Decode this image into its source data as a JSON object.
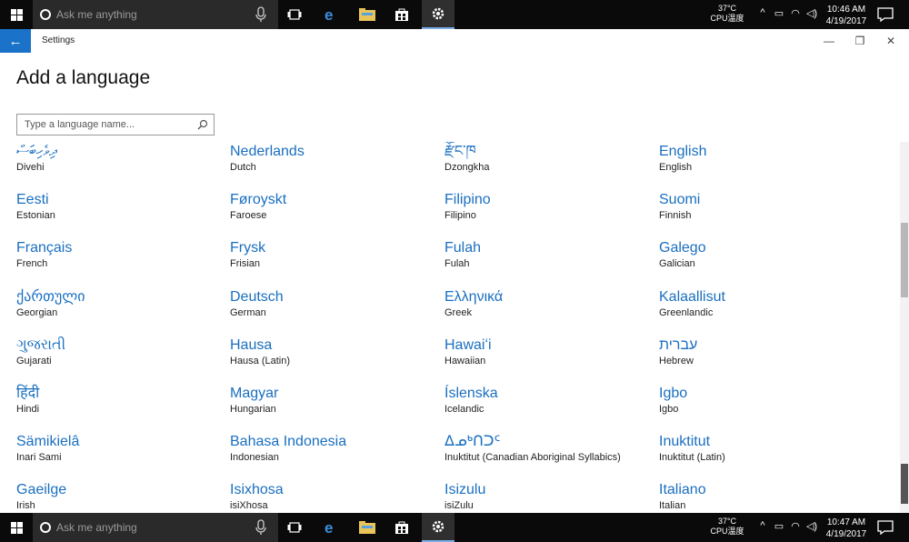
{
  "taskbar_top": {
    "search_placeholder": "Ask me anything",
    "temp": "37°C",
    "temp_label": "CPU温度",
    "time": "10:46 AM",
    "date": "4/19/2017"
  },
  "taskbar_bottom": {
    "search_placeholder": "Ask me anything",
    "temp": "37°C",
    "temp_label": "CPU温度",
    "time": "10:47 AM",
    "date": "4/19/2017"
  },
  "window": {
    "app_title": "Settings"
  },
  "page": {
    "title": "Add a language",
    "search_placeholder": "Type a language name..."
  },
  "languages": [
    {
      "native": "ދިވެހިބަސް",
      "english": "Divehi"
    },
    {
      "native": "Nederlands",
      "english": "Dutch"
    },
    {
      "native": "རྫོང་ཁ",
      "english": "Dzongkha"
    },
    {
      "native": "English",
      "english": "English"
    },
    {
      "native": "Eesti",
      "english": "Estonian"
    },
    {
      "native": "Føroyskt",
      "english": "Faroese"
    },
    {
      "native": "Filipino",
      "english": "Filipino"
    },
    {
      "native": "Suomi",
      "english": "Finnish"
    },
    {
      "native": "Français",
      "english": "French"
    },
    {
      "native": "Frysk",
      "english": "Frisian"
    },
    {
      "native": "Fulah",
      "english": "Fulah"
    },
    {
      "native": "Galego",
      "english": "Galician"
    },
    {
      "native": "ქართული",
      "english": "Georgian"
    },
    {
      "native": "Deutsch",
      "english": "German"
    },
    {
      "native": "Ελληνικά",
      "english": "Greek"
    },
    {
      "native": "Kalaallisut",
      "english": "Greenlandic"
    },
    {
      "native": "ગુજરાતી",
      "english": "Gujarati"
    },
    {
      "native": "Hausa",
      "english": "Hausa (Latin)"
    },
    {
      "native": "Hawaiʻi",
      "english": "Hawaiian"
    },
    {
      "native": "עברית",
      "english": "Hebrew"
    },
    {
      "native": "हिंदी",
      "english": "Hindi"
    },
    {
      "native": "Magyar",
      "english": "Hungarian"
    },
    {
      "native": "Íslenska",
      "english": "Icelandic"
    },
    {
      "native": "Igbo",
      "english": "Igbo"
    },
    {
      "native": "Sämikielâ",
      "english": "Inari Sami"
    },
    {
      "native": "Bahasa Indonesia",
      "english": "Indonesian"
    },
    {
      "native": "ᐃᓄᒃᑎᑐᑦ",
      "english": "Inuktitut (Canadian Aboriginal Syllabics)"
    },
    {
      "native": "Inuktitut",
      "english": "Inuktitut (Latin)"
    },
    {
      "native": "Gaeilge",
      "english": "Irish"
    },
    {
      "native": "Isixhosa",
      "english": "isiXhosa"
    },
    {
      "native": "Isizulu",
      "english": "isiZulu"
    },
    {
      "native": "Italiano",
      "english": "Italian"
    }
  ]
}
